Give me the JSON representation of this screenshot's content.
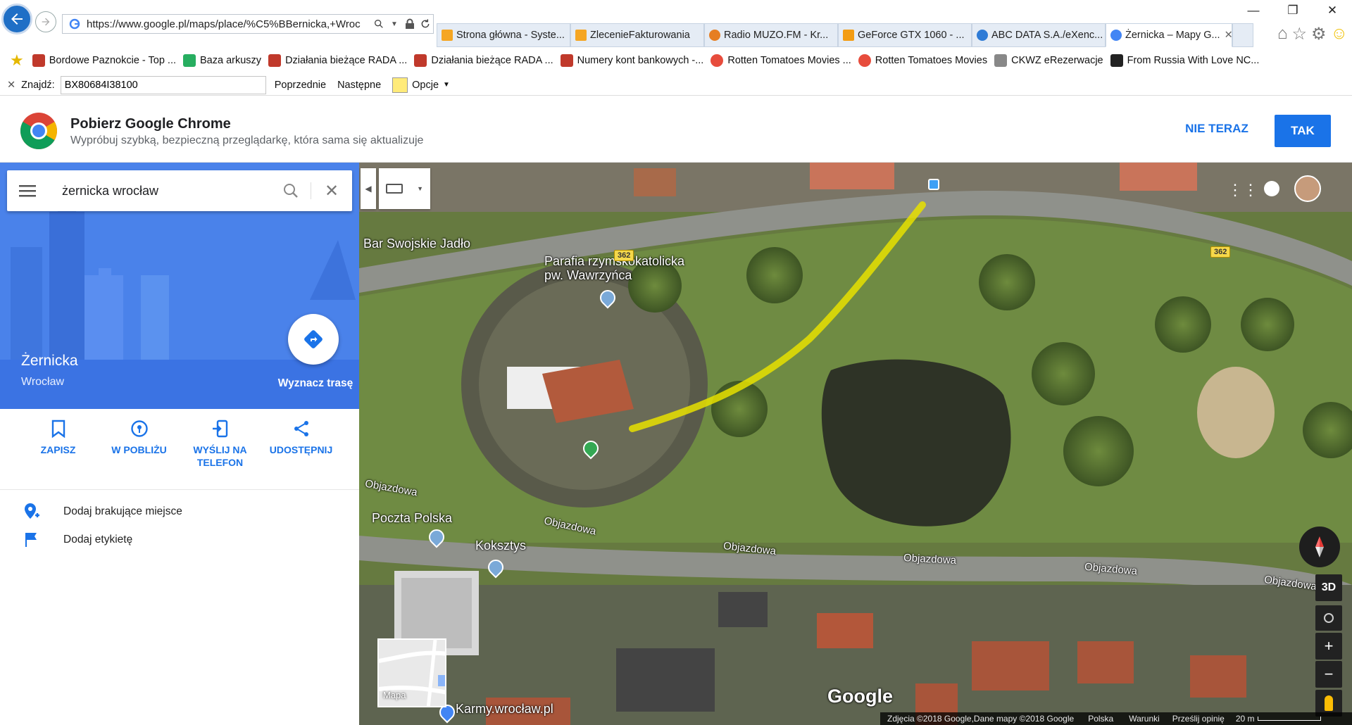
{
  "browser": {
    "url": "https://www.google.pl/maps/place/%C5%BBernicka,+Wroc",
    "tabs": [
      {
        "label": "Strona główna - Syste...",
        "color": "#f5a623"
      },
      {
        "label": "ZlecenieFakturowania",
        "color": "#f5a623"
      },
      {
        "label": "Radio MUZO.FM - Kr...",
        "color": "#e67e22"
      },
      {
        "label": "GeForce GTX 1060 - ...",
        "color": "#f39c12"
      },
      {
        "label": "ABC DATA S.A./eXenc...",
        "color": "#2e7bd6"
      },
      {
        "label": "Żernicka – Mapy G...",
        "color": "#4285f4"
      }
    ],
    "favorites": [
      {
        "label": "Bordowe Paznokcie - Top ...",
        "color": "#c0392b"
      },
      {
        "label": "Baza arkuszy",
        "color": "#27ae60"
      },
      {
        "label": "Działania bieżące  RADA ...",
        "color": "#c0392b"
      },
      {
        "label": "Działania bieżące  RADA ...",
        "color": "#c0392b"
      },
      {
        "label": "Numery kont bankowych -...",
        "color": "#c0392b"
      },
      {
        "label": "Rotten Tomatoes Movies  ...",
        "color": "#e74c3c"
      },
      {
        "label": "Rotten Tomatoes Movies",
        "color": "#e74c3c"
      },
      {
        "label": "CKWZ eRezerwacje",
        "color": "#888888"
      },
      {
        "label": "From Russia With Love NC...",
        "color": "#222222"
      }
    ],
    "find": {
      "label": "Znajdź:",
      "value": "BX80684I38100",
      "prev": "Poprzednie",
      "next": "Następne",
      "options": "Opcje"
    }
  },
  "promo": {
    "title": "Pobierz Google Chrome",
    "subtitle": "Wypróbuj szybką, bezpieczną przeglądarkę, która sama się aktualizuje",
    "dismiss": "NIE TERAZ",
    "accept": "TAK"
  },
  "sidebar": {
    "query": "żernicka wrocław",
    "place_name": "Żernicka",
    "place_city": "Wrocław",
    "directions": "Wyznacz trasę",
    "actions": [
      {
        "label": "ZAPISZ"
      },
      {
        "label": "W POBLIŻU"
      },
      {
        "label": "WYŚLIJ NA TELEFON"
      },
      {
        "label": "UDOSTĘPNIJ"
      }
    ],
    "add_place": "Dodaj brakujące miejsce",
    "add_label": "Dodaj etykietę"
  },
  "map": {
    "labels": {
      "bar": "Bar Swojskie Jadło",
      "church_1": "Parafia rzymskokatolicka",
      "church_2": "pw. Wawrzyńca",
      "post": "Poczta Polska",
      "koksztys": "Koksztys",
      "karmy": "Karmy.wrocław.pl",
      "street": "Objazdowa",
      "road_num": "362"
    },
    "minimap": "Mapa",
    "threed": "3D",
    "watermark": "Google",
    "footer": {
      "copyright": "Zdjęcia ©2018 Google,Dane mapy ©2018 Google",
      "country": "Polska",
      "terms": "Warunki",
      "feedback": "Prześlij opinię",
      "scale": "20 m"
    }
  }
}
